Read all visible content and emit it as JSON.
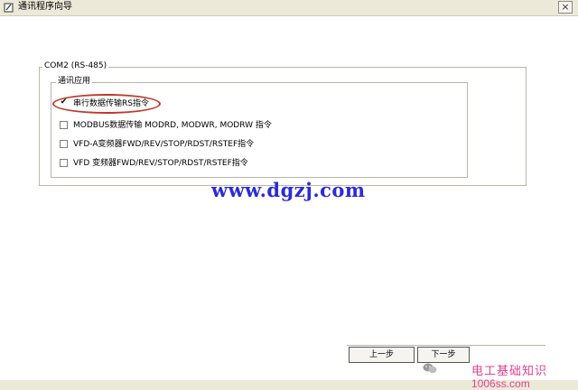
{
  "window": {
    "title": "通讯程序向导",
    "close_glyph": "×"
  },
  "group_outer": {
    "legend": "COM2 (RS-485)"
  },
  "group_inner": {
    "legend": "通讯应用"
  },
  "options": [
    {
      "label": "串行数据传输RS指令",
      "checked": true
    },
    {
      "label": "MODBUS数据传输 MODRD, MODWR, MODRW 指令",
      "checked": false
    },
    {
      "label": "VFD-A变频器FWD/REV/STOP/RDST/RSTEF指令",
      "checked": false
    },
    {
      "label": "VFD 变频器FWD/REV/STOP/RDST/RSTEF指令",
      "checked": false
    }
  ],
  "watermark": "www.dgzj.com",
  "buttons": {
    "prev": "上一步",
    "next": "下一步"
  },
  "branding": {
    "cn": "电工基础知识",
    "site": "1006ss.com"
  },
  "colors": {
    "highlight": "#c0392b",
    "watermark": "#2b2bd6",
    "brand": "#e0418f"
  }
}
